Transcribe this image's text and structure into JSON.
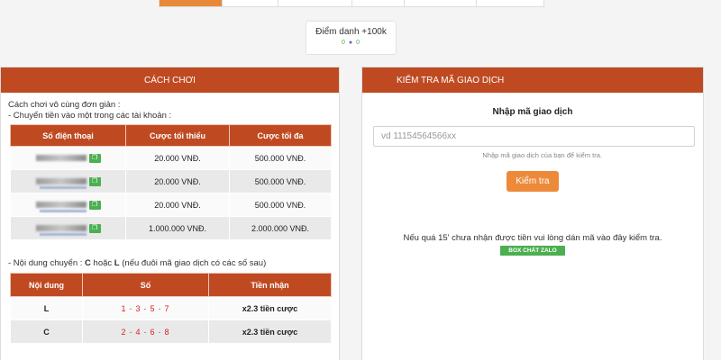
{
  "checkin": {
    "label": "Điểm danh +100k",
    "sub": "0",
    "sub2": "0"
  },
  "left": {
    "title": "CÁCH CHƠI",
    "intro": "Cách chơi vô cùng đơn giản :",
    "intro2": "- Chuyển tiền vào một trong các tài khoản :",
    "table1": {
      "headers": [
        "Số điện thoại",
        "Cược tối thiểu",
        "Cược tối đa"
      ],
      "rows": [
        {
          "min": "20.000 VNĐ.",
          "max": "500.000 VNĐ."
        },
        {
          "min": "20.000 VNĐ.",
          "max": "500.000 VNĐ."
        },
        {
          "min": "20.000 VNĐ.",
          "max": "500.000 VNĐ."
        },
        {
          "min": "1.000.000 VNĐ.",
          "max": "2.000.000 VNĐ."
        }
      ]
    },
    "content_prefix": "- Nội dung chuyển : ",
    "content_c": "C",
    "content_or": " hoặc ",
    "content_l": "L",
    "content_suffix": " (nếu đuôi mã giao dịch có các số sau)",
    "table2": {
      "headers": [
        "Nội dung",
        "Số",
        "Tiền nhận"
      ],
      "rows": [
        {
          "code": "L",
          "n": [
            "1",
            "3",
            "5",
            "7"
          ],
          "reward": "x2.3 tiền cược"
        },
        {
          "code": "C",
          "n": [
            "2",
            "4",
            "6",
            "8"
          ],
          "reward": "x2.3 tiền cược"
        }
      ]
    }
  },
  "right": {
    "title": "KIỂM TRA MÃ GIAO DỊCH",
    "form_title": "Nhập mã giao dịch",
    "placeholder": "vd 11154564566xx",
    "help": "Nhập mã giao dịch của bạn để kiểm tra.",
    "button": "Kiểm tra",
    "note": "Nếu quá 15' chưa nhận được tiền vui lòng dán mã vào đây kiểm tra.",
    "zalo": "BOX CHÁT ZALO"
  },
  "colors": {
    "accent": "#bf4a22",
    "button": "#ed8a3a",
    "green": "#4caf50",
    "number_red": "#d8202b"
  }
}
